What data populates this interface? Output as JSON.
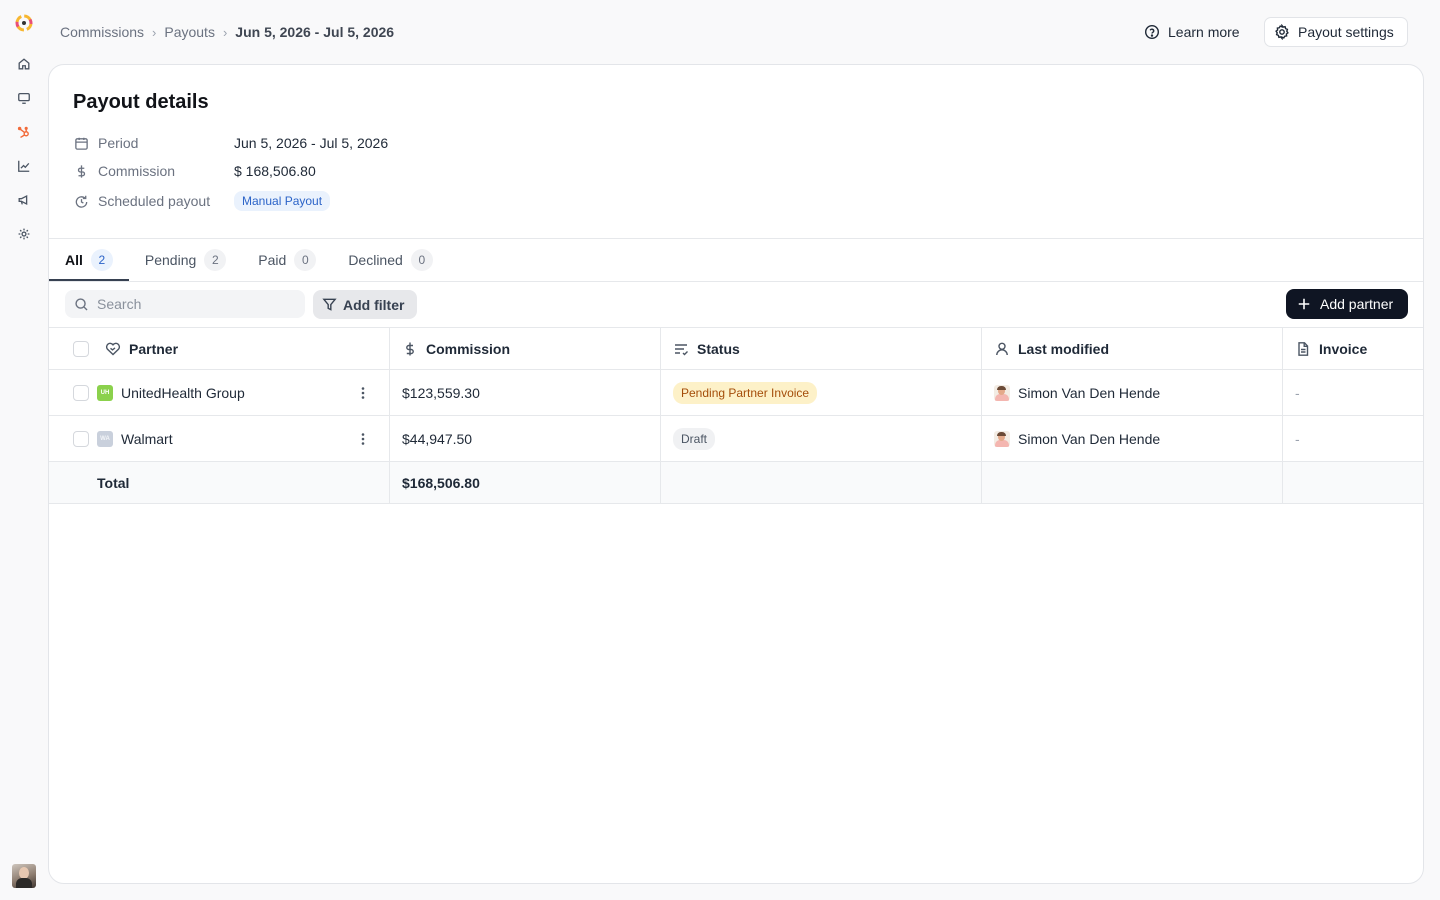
{
  "breadcrumb": {
    "items": [
      "Commissions",
      "Payouts"
    ],
    "current": "Jun 5, 2026 - Jul 5, 2026"
  },
  "header": {
    "learn_more": "Learn more",
    "payout_settings": "Payout settings"
  },
  "details": {
    "title": "Payout details",
    "period_label": "Period",
    "period_value": "Jun 5, 2026 - Jul 5, 2026",
    "commission_label": "Commission",
    "commission_value": "$ 168,506.80",
    "scheduled_label": "Scheduled payout",
    "scheduled_value": "Manual Payout"
  },
  "tabs": [
    {
      "label": "All",
      "count": "2"
    },
    {
      "label": "Pending",
      "count": "2"
    },
    {
      "label": "Paid",
      "count": "0"
    },
    {
      "label": "Declined",
      "count": "0"
    }
  ],
  "toolbar": {
    "search_placeholder": "Search",
    "add_filter": "Add filter",
    "add_partner": "Add partner"
  },
  "table": {
    "columns": [
      "Partner",
      "Commission",
      "Status",
      "Last modified",
      "Invoice"
    ],
    "rows": [
      {
        "logo": "UH",
        "partner": "UnitedHealth Group",
        "commission": "$123,559.30",
        "status": "Pending Partner Invoice",
        "modified_by": "Simon Van Den Hende",
        "invoice": "-"
      },
      {
        "logo": "WA",
        "partner": "Walmart",
        "commission": "$44,947.50",
        "status": "Draft",
        "modified_by": "Simon Van Den Hende",
        "invoice": "-"
      }
    ],
    "total_label": "Total",
    "total_value": "$168,506.80"
  },
  "colors": {
    "primary_button": "#0f1523",
    "pending_badge_bg": "#fdf1c8",
    "pending_badge_text": "#a44d0a",
    "manual_badge_bg": "#eaf2fd",
    "manual_badge_text": "#2c64c8",
    "brand_accent": "#f26b3a"
  }
}
